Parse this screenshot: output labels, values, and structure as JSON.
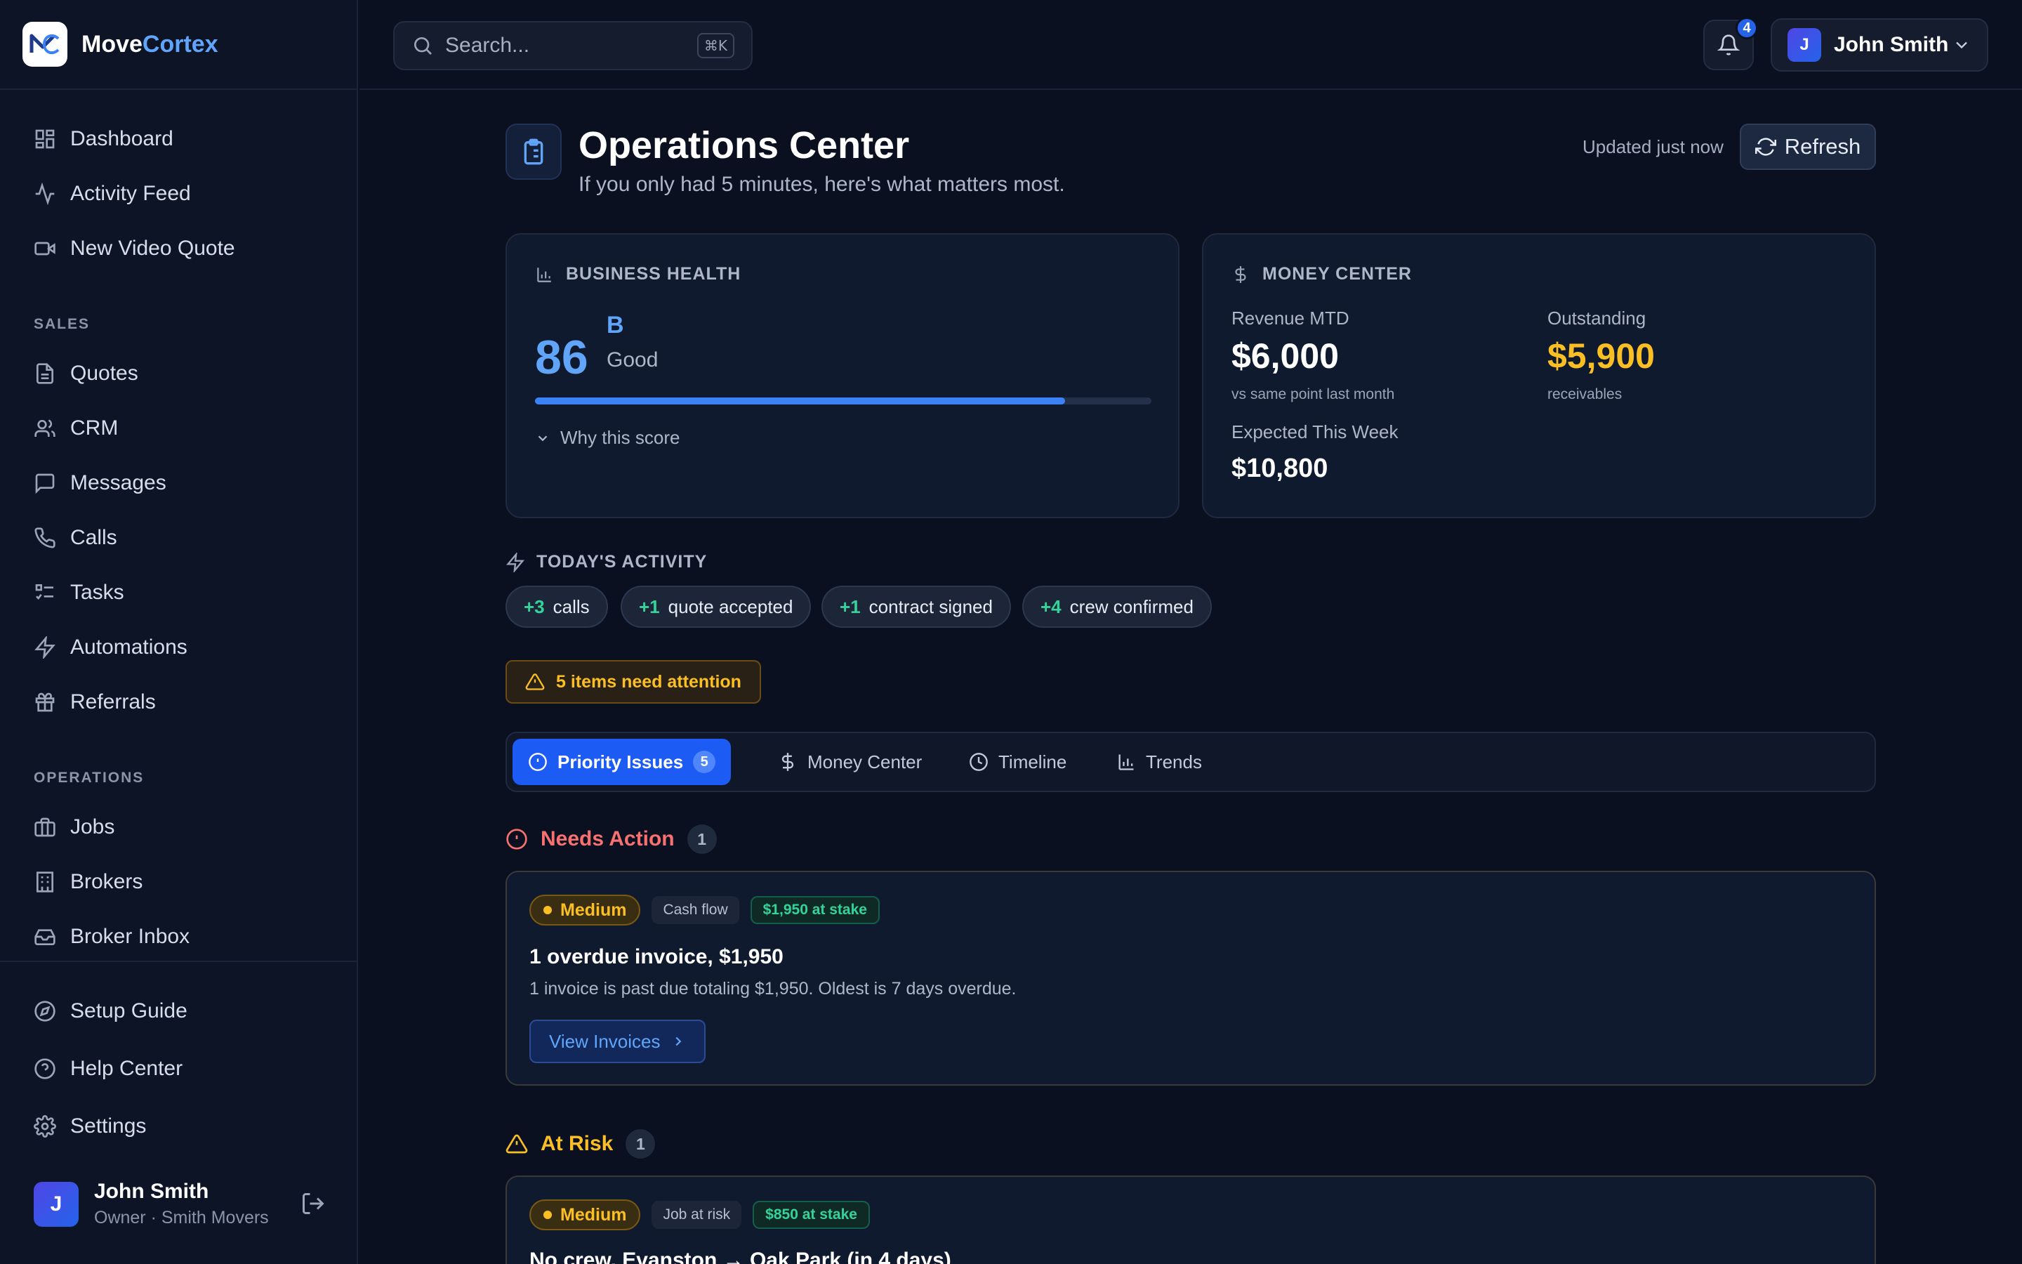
{
  "app": {
    "brand_main": "Move",
    "brand_accent": "Cortex"
  },
  "nav": {
    "main": [
      {
        "label": "Dashboard",
        "icon": "dashboard-icon"
      },
      {
        "label": "Activity Feed",
        "icon": "activity-icon"
      },
      {
        "label": "New Video Quote",
        "icon": "video-icon"
      }
    ],
    "sales_title": "SALES",
    "sales": [
      {
        "label": "Quotes",
        "icon": "document-icon"
      },
      {
        "label": "CRM",
        "icon": "users-icon"
      },
      {
        "label": "Messages",
        "icon": "message-icon"
      },
      {
        "label": "Calls",
        "icon": "phone-icon"
      },
      {
        "label": "Tasks",
        "icon": "tasks-icon"
      },
      {
        "label": "Automations",
        "icon": "lightning-icon"
      },
      {
        "label": "Referrals",
        "icon": "gift-icon"
      }
    ],
    "operations_title": "OPERATIONS",
    "operations": [
      {
        "label": "Jobs",
        "icon": "briefcase-icon"
      },
      {
        "label": "Brokers",
        "icon": "building-icon"
      },
      {
        "label": "Broker Inbox",
        "icon": "inbox-icon"
      }
    ],
    "bottom": [
      {
        "label": "Setup Guide",
        "icon": "compass-icon"
      },
      {
        "label": "Help Center",
        "icon": "help-icon"
      },
      {
        "label": "Settings",
        "icon": "gear-icon"
      }
    ]
  },
  "sidebar_user": {
    "initial": "J",
    "name": "John Smith",
    "role": "Owner",
    "separator": "·",
    "company": "Smith Movers"
  },
  "header": {
    "search_placeholder": "Search...",
    "search_shortcut": "⌘K",
    "notifications_count": "4",
    "user_initial": "J",
    "user_name": "John Smith"
  },
  "page": {
    "title": "Operations Center",
    "subtitle": "If you only had 5 minutes, here's what matters most.",
    "updated": "Updated just now",
    "refresh_label": "Refresh"
  },
  "health": {
    "title": "BUSINESS HEALTH",
    "score": "86",
    "grade": "B",
    "grade_label": "Good",
    "score_fraction": 0.86,
    "why_label": "Why this score"
  },
  "money": {
    "title": "MONEY CENTER",
    "revenue_label": "Revenue MTD",
    "revenue_value": "$6,000",
    "revenue_sub": "vs same point last month",
    "outstanding_label": "Outstanding",
    "outstanding_value": "$5,900",
    "outstanding_sub": "receivables",
    "expected_label": "Expected This Week",
    "expected_value": "$10,800"
  },
  "activity": {
    "title": "TODAY'S ACTIVITY",
    "chips": [
      {
        "count": "+3",
        "label": "calls"
      },
      {
        "count": "+1",
        "label": "quote accepted"
      },
      {
        "count": "+1",
        "label": "contract signed"
      },
      {
        "count": "+4",
        "label": "crew confirmed"
      }
    ]
  },
  "attention": {
    "label": "5 items need attention"
  },
  "tabs": [
    {
      "label": "Priority Issues",
      "count": "5",
      "active": true
    },
    {
      "label": "Money Center"
    },
    {
      "label": "Timeline"
    },
    {
      "label": "Trends"
    }
  ],
  "needs_action": {
    "title": "Needs Action",
    "count": "1",
    "issue": {
      "severity": "Medium",
      "category": "Cash flow",
      "stake": "$1,950 at stake",
      "title": "1 overdue invoice, $1,950",
      "description": "1 invoice is past due totaling $1,950. Oldest is 7 days overdue.",
      "action": "View Invoices"
    }
  },
  "at_risk": {
    "title": "At Risk",
    "count": "1",
    "issue": {
      "severity": "Medium",
      "category": "Job at risk",
      "stake": "$850 at stake",
      "title": "No crew, Evanston → Oak Park (in 4 days)"
    }
  },
  "colors": {
    "accent": "#3b82f6",
    "warning": "#fbbf24",
    "success": "#34d399",
    "danger": "#f87171"
  }
}
